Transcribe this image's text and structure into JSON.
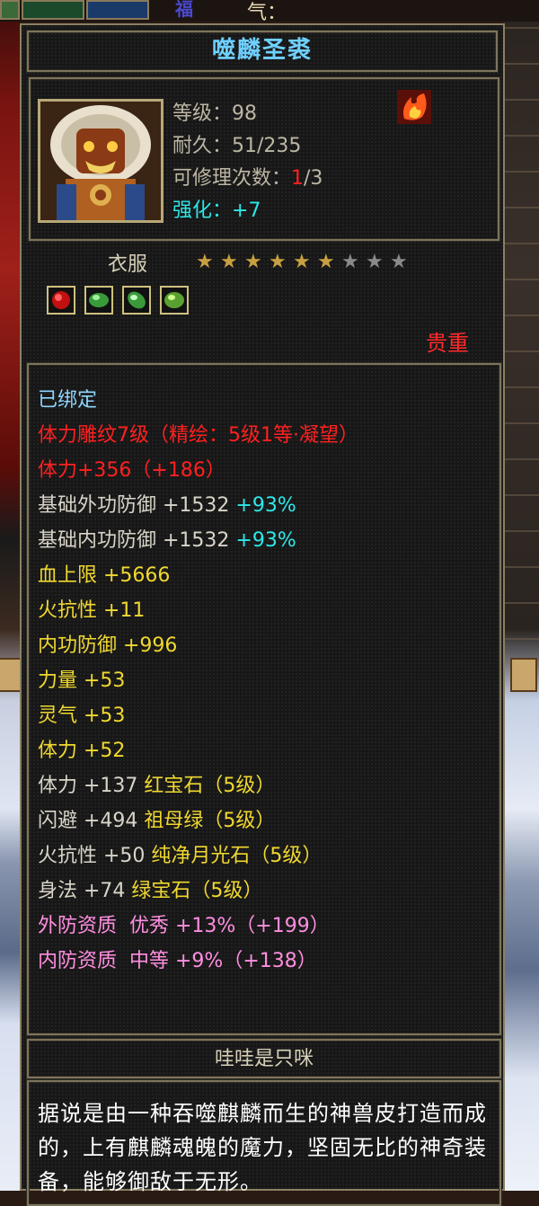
{
  "top": {
    "partial_label_blue": "福",
    "partial_label": "气："
  },
  "item": {
    "name": "噬麟圣裘",
    "level_label": "等级：98",
    "durability_label": "耐久：51/235",
    "repair_prefix": "可修理次数：",
    "repair_used": "1",
    "repair_suffix": "/3",
    "enhance_label": "强化：",
    "enhance_value": "+7",
    "category": "衣服",
    "stars_filled": 6,
    "stars_total": 9,
    "rarity": "贵重",
    "gem_slots": [
      "red-gem-icon",
      "green-gem-icon",
      "green-gem-icon",
      "green-gem-icon"
    ]
  },
  "stats": {
    "bound": "已绑定",
    "engrave": "体力雕纹7级（精绘：5级1等·凝望）",
    "vit_main": "体力+356（+186）",
    "ext_def": "基础外功防御 +1532",
    "ext_def_pct": "+93%",
    "int_def": "基础内功防御 +1532",
    "int_def_pct": "+93%",
    "hp": "血上限 +5666",
    "fire_res": "火抗性 +11",
    "inner_def": "内功防御 +996",
    "str": "力量 +53",
    "spirit": "灵气 +53",
    "vit": "体力 +52",
    "gem1_stat": "体力 +137",
    "gem1_name": "红宝石（5级）",
    "gem2_stat": "闪避 +494",
    "gem2_name": "祖母绿（5级）",
    "gem3_stat": "火抗性 +50",
    "gem3_name": "纯净月光石（5级）",
    "gem4_stat": "身法 +74",
    "gem4_name": "绿宝石（5级）",
    "apt1": "外防资质  优秀 +13%（+199）",
    "apt2": "内防资质  中等 +9%（+138）"
  },
  "owner": "哇哇是只咪",
  "description": "据说是由一种吞噬麒麟而生的神兽皮打造而成的，上有麒麟魂魄的魔力，坚固无比的神奇装备，能够御敌于无形。",
  "colors": {
    "title": "#6fd0ff",
    "red": "#ff2020",
    "cyan": "#2ee8e8",
    "yellow": "#f0d830",
    "pink": "#ff8ee0",
    "star_filled": "#c8a040",
    "star_empty": "#8a8a8a"
  }
}
